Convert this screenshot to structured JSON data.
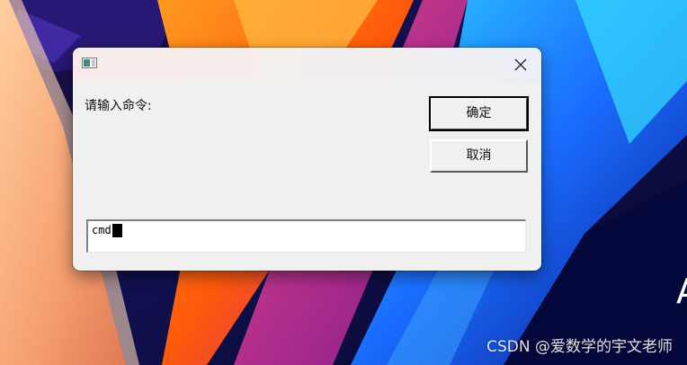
{
  "dialog": {
    "prompt": "请输入命令:",
    "ok_label": "确定",
    "cancel_label": "取消",
    "input_value": "cmd"
  },
  "watermark": "CSDN @爱数学的宇文老师",
  "edge_glyph": "A",
  "icons": {
    "app": "app-window-icon",
    "close": "close-icon"
  },
  "colors": {
    "dialog_bg": "#f0f0f0",
    "wallpaper_dark": "#0a0a2e",
    "wallpaper_orange": "#ff6a10",
    "wallpaper_blue": "#1a8cff"
  }
}
